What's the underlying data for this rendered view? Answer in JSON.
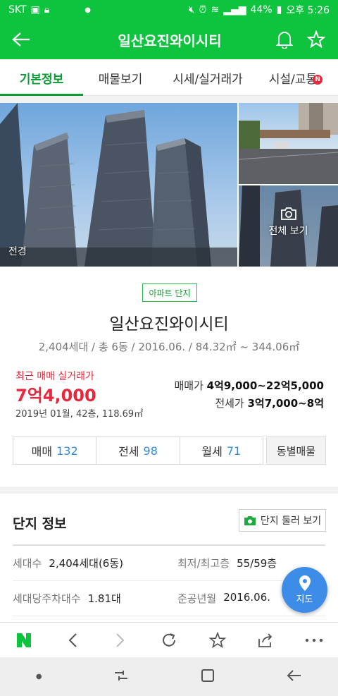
{
  "status": {
    "carrier": "SKT",
    "battery": "44%",
    "time": "오후 5:26"
  },
  "header": {
    "title": "일산요진와이시티"
  },
  "tabs": [
    {
      "label": "기본정보"
    },
    {
      "label": "매물보기"
    },
    {
      "label": "시세/실거래가"
    },
    {
      "label": "시설/교통",
      "badge": "N"
    }
  ],
  "photos": {
    "main_label": "전경",
    "view_all": "전체 보기"
  },
  "summary": {
    "tag": "아파트 단지",
    "name": "일산요진와이시티",
    "subtitle": "2,404세대 / 총 6동 / 2016.06. / 84.32㎡ ~ 344.06㎡",
    "recent_label": "최근 매매 실거래가",
    "recent_price": "7억4,000",
    "recent_detail": "2019년 01월, 42층, 118.69㎡",
    "sale_label": "매매가",
    "sale_value": "4억9,000~22억5,000",
    "lease_label": "전세가",
    "lease_value": "3억7,000~8억"
  },
  "deals": [
    {
      "label": "매매",
      "count": "132"
    },
    {
      "label": "전세",
      "count": "98"
    },
    {
      "label": "월세",
      "count": "71"
    }
  ],
  "dong_button": "동별매물",
  "complex": {
    "heading": "단지 정보",
    "look_button": "단지 둘러 보기",
    "rows": [
      {
        "k1": "세대수",
        "v1": "2,404세대(6동)",
        "k2": "최저/최고층",
        "v2": "55/59층"
      },
      {
        "k1": "세대당주차대수",
        "v1": "1.81대",
        "k2": "준공년월",
        "v2": "2016.06."
      }
    ]
  },
  "fab": {
    "label": "지도"
  },
  "colors": {
    "brand": "#0ec43f",
    "price_red": "#e8283c",
    "count_blue": "#2f8de0",
    "fab": "#3d8ce8"
  }
}
